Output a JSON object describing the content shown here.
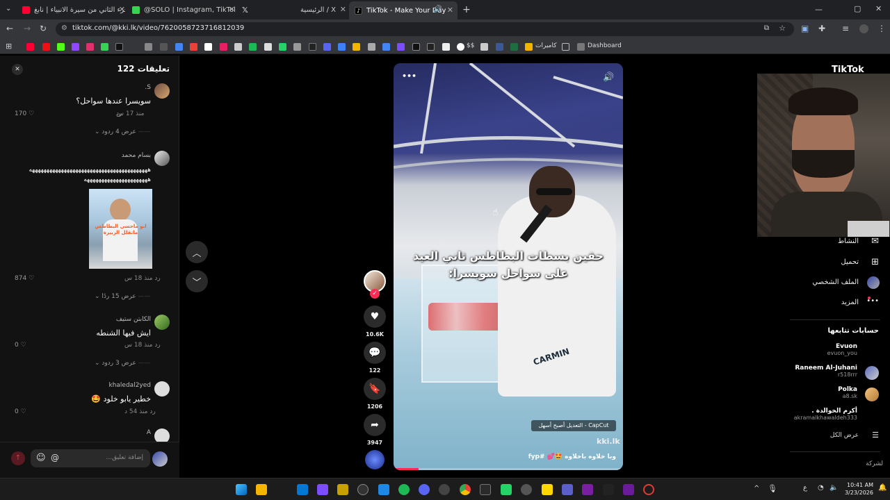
{
  "browser": {
    "tabs": [
      {
        "title": "الجزء الثاني من سيرة الانبياء | نابغ...",
        "color": "#ff0033"
      },
      {
        "title": "@SOLO | Instagram, TikTok | Lin...",
        "color": "#39d353"
      },
      {
        "title": "",
        "color": "#ffffff"
      },
      {
        "title": "الرئيسية / X",
        "color": "#ffffff"
      },
      {
        "title": "TikTok - Make Your Day",
        "color": "#ffffff"
      }
    ],
    "url": "tiktok.com/@kki.lk/video/7620058723716812039",
    "bookmarks": {
      "cameras_label": "كاميرات",
      "dollar_label": "$$",
      "dashboard_label": "Dashboard"
    }
  },
  "comments": {
    "header": "تعليقات 122",
    "input_placeholder": "إضافة تعليق...",
    "emoji_icon": "☺",
    "mention_icon": "@",
    "items": [
      {
        "name": "S.",
        "text": "سويسرا عندها سواحل؟",
        "time": "منذ 17 س",
        "reply": "رد",
        "likes": "170",
        "more": "عرض 4 ردود"
      },
      {
        "name": "بسام محمد",
        "text": "هههههههههههههههههههههههههههههههههههههههههه",
        "text2": "ههههههههههههههههههههههه",
        "time": "منذ 18 س",
        "reply": "رد",
        "likes": "874",
        "more": "عرض 15 ردًا",
        "sticker": "ابو ماحسي البطاطس ماتقلل الزبيرة"
      },
      {
        "name": "الكابتن ستيف",
        "text": "ايش فيها الشنطه",
        "time": "منذ 18 س",
        "reply": "رد",
        "likes": "0",
        "more": "عرض 3 ردود"
      },
      {
        "name": "khaledal2yed",
        "text": "خطير يابو خلود 🤩",
        "time": "منذ 54 د",
        "reply": "رد",
        "likes": "0"
      },
      {
        "name": "A"
      }
    ]
  },
  "video": {
    "caption_line1": "حقين بسطات البطاطس ثاني العيد",
    "caption_line2": "على سواحل سويسرا:",
    "capcut_badge": "CapCut - التعديل أصبح أسهل",
    "watermark": "kki.lk",
    "description": "وبا خلاوه باخلاوه 🤩💕 #fyp",
    "more_icon": "•••",
    "progress": 0.11
  },
  "actions": [
    {
      "icon": "♥",
      "count": "10.6K",
      "name": "like"
    },
    {
      "icon": "💬",
      "count": "122",
      "name": "comment"
    },
    {
      "icon": "🔖",
      "count": "1206",
      "name": "save"
    },
    {
      "icon": "➦",
      "count": "3947",
      "name": "share"
    }
  ],
  "sidebar": {
    "logo": "TikTok",
    "nav": [
      {
        "label": "النشاط",
        "icon": "✉"
      },
      {
        "label": "تحميل",
        "icon": "⊞"
      },
      {
        "label": "الملف الشخصي",
        "icon": "◉"
      },
      {
        "label": "المزيد",
        "icon": "•••"
      }
    ],
    "following_title": "حسابات تتابعها",
    "following": [
      {
        "name": "Evuon",
        "handle": "evuon_you"
      },
      {
        "name": "Raneem Al-Juhani",
        "handle": "r518rrr"
      },
      {
        "name": "Polka",
        "handle": "a8.sk"
      },
      {
        "name": "أكرم الخوالدة .",
        "handle": "akramalkhawaldeh333"
      }
    ],
    "see_all": "عرض الكل",
    "company": "لشركة"
  },
  "taskbar": {
    "time": "10:41 AM",
    "date": "3/23/2026",
    "lang": "ع"
  }
}
